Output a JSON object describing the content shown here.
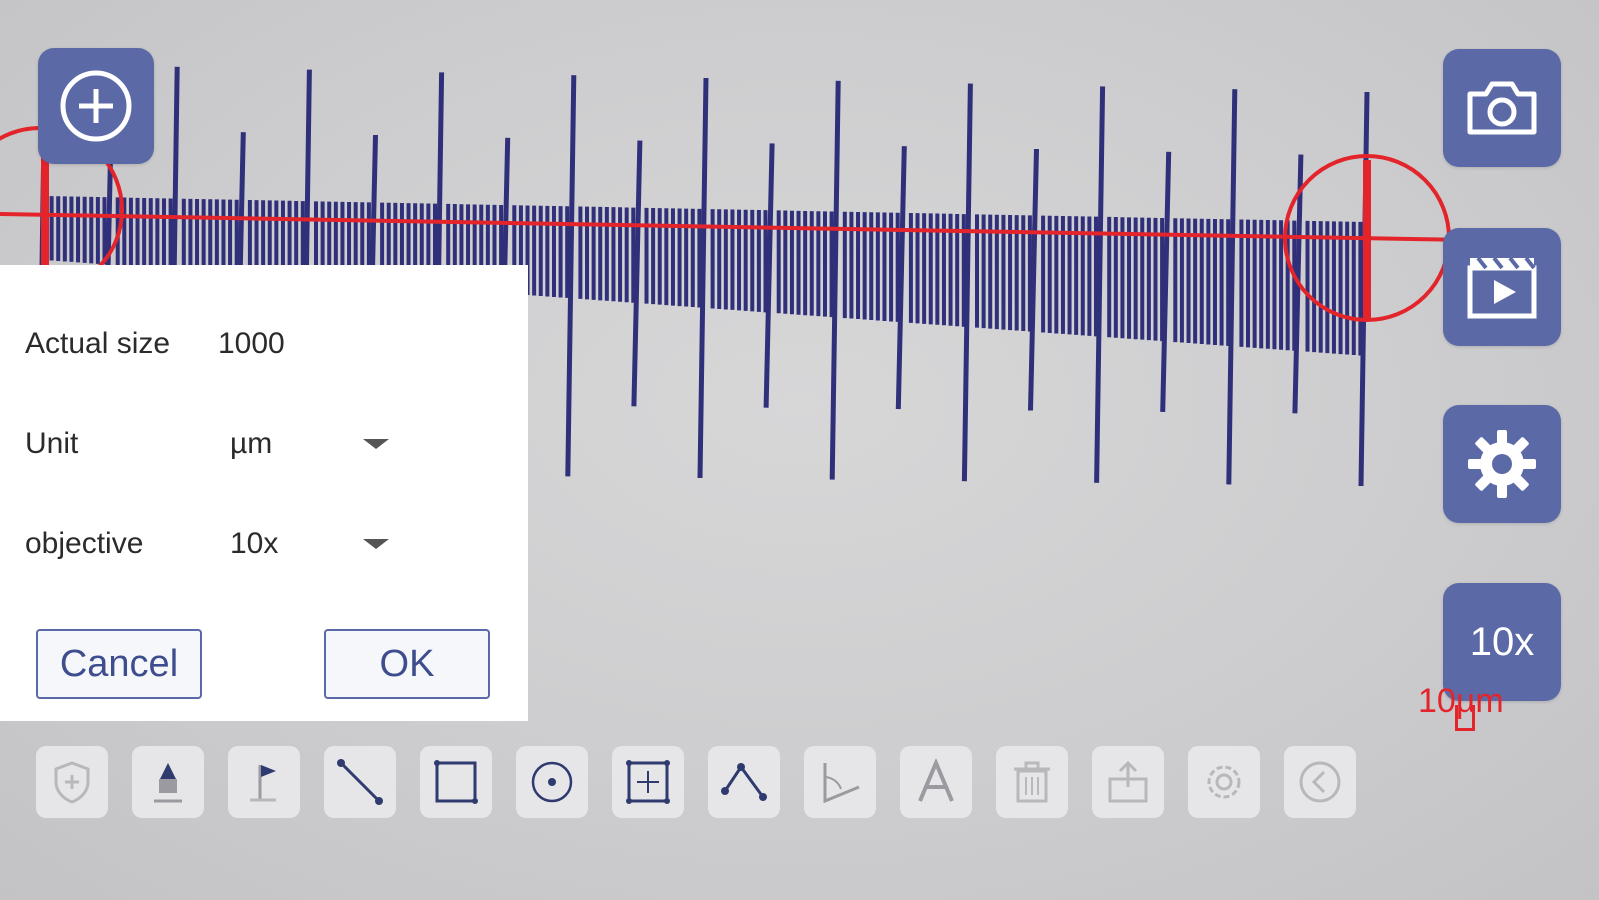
{
  "calibration": {
    "actual_size_label": "Actual size",
    "actual_size_value": "1000",
    "unit_label": "Unit",
    "unit_value": "µm",
    "objective_label": "objective",
    "objective_value": "10x",
    "cancel_label": "Cancel",
    "ok_label": "OK"
  },
  "side_buttons": {
    "magnification_label": "10x"
  },
  "scale_bar": {
    "label": "10µm"
  },
  "colors": {
    "button_blue": "#5b6aa6",
    "measure_red": "#e3252b",
    "ruler_line": "#2f2f7a"
  },
  "icons": {
    "top_left": "add-circle-icon",
    "side": [
      "camera-icon",
      "video-icon",
      "gear-icon"
    ],
    "toolbar": [
      "shield-add-icon",
      "pen-marker-icon",
      "flag-icon",
      "line-icon",
      "rectangle-icon",
      "circle-icon",
      "grid-icon",
      "polyline-icon",
      "angle-icon",
      "text-icon",
      "trash-icon",
      "export-icon",
      "settings-icon",
      "back-icon"
    ]
  }
}
